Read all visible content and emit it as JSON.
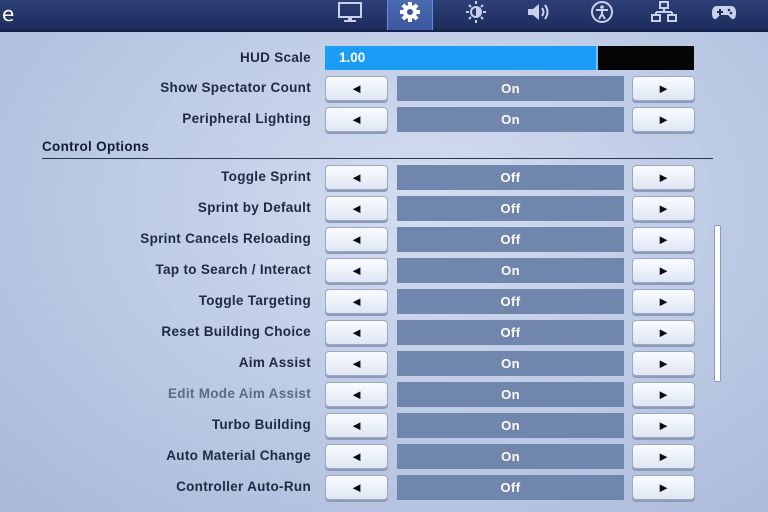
{
  "header": {
    "title_fragment": "e",
    "tabs": [
      {
        "name": "display-tab",
        "icon": "monitor-icon",
        "active": false
      },
      {
        "name": "game-tab",
        "icon": "gear-icon",
        "active": true
      },
      {
        "name": "brightness-tab",
        "icon": "brightness-icon",
        "active": false
      },
      {
        "name": "audio-tab",
        "icon": "speaker-icon",
        "active": false
      },
      {
        "name": "accessibility-tab",
        "icon": "accessibility-icon",
        "active": false
      },
      {
        "name": "input-tab",
        "icon": "network-icon",
        "active": false
      },
      {
        "name": "controller-tab",
        "icon": "controller-icon",
        "active": false
      }
    ]
  },
  "hud_scale": {
    "label": "HUD Scale",
    "value": "1.00",
    "fill_fraction": 0.74,
    "fill_color": "#1a9cf7"
  },
  "top_settings": [
    {
      "label": "Show Spectator Count",
      "value": "On"
    },
    {
      "label": "Peripheral Lighting",
      "value": "On"
    }
  ],
  "control_options": {
    "title": "Control Options",
    "settings": [
      {
        "label": "Toggle Sprint",
        "value": "Off"
      },
      {
        "label": "Sprint by Default",
        "value": "Off"
      },
      {
        "label": "Sprint Cancels Reloading",
        "value": "Off"
      },
      {
        "label": "Tap to Search / Interact",
        "value": "On"
      },
      {
        "label": "Toggle Targeting",
        "value": "Off"
      },
      {
        "label": "Reset Building Choice",
        "value": "Off"
      },
      {
        "label": "Aim Assist",
        "value": "On"
      },
      {
        "label": "Edit Mode Aim Assist",
        "value": "On",
        "disabled": true
      },
      {
        "label": "Turbo Building",
        "value": "On"
      },
      {
        "label": "Auto Material Change",
        "value": "On"
      },
      {
        "label": "Controller Auto-Run",
        "value": "Off"
      }
    ]
  },
  "arrows": {
    "left": "◄",
    "right": "►"
  },
  "colors": {
    "topbar": "#1d2c5c",
    "value_box": "#7186ad",
    "background": "#bcc9e4"
  }
}
